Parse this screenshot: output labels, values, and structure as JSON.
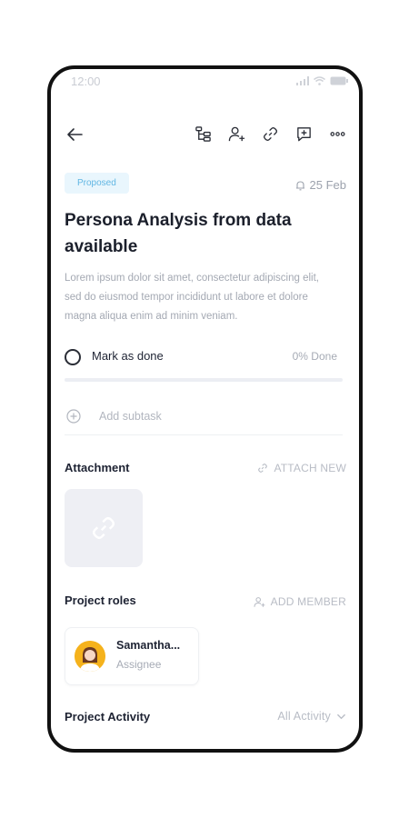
{
  "status_bar": {
    "time": "12:00"
  },
  "task": {
    "status": "Proposed",
    "date": "25 Feb",
    "title": "Persona Analysis from data available",
    "description": "Lorem ipsum dolor sit amet, consectetur adipiscing elit, sed do eiusmod tempor incididunt ut labore et dolore magna aliqua enim ad minim veniam.",
    "mark_done_label": "Mark as done",
    "progress_text": "0% Done",
    "progress_value": 0,
    "add_subtask_label": "Add subtask"
  },
  "attachment": {
    "heading": "Attachment",
    "action": "ATTACH NEW"
  },
  "roles": {
    "heading": "Project roles",
    "action": "ADD MEMBER",
    "members": [
      {
        "name": "Samantha...",
        "role": "Assignee"
      }
    ]
  },
  "activity": {
    "heading": "Project Activity",
    "filter": "All Activity"
  },
  "colors": {
    "accent": "#61b6e3",
    "badge_bg": "#e9f6fd",
    "avatar_bg": "#f5b21c"
  }
}
